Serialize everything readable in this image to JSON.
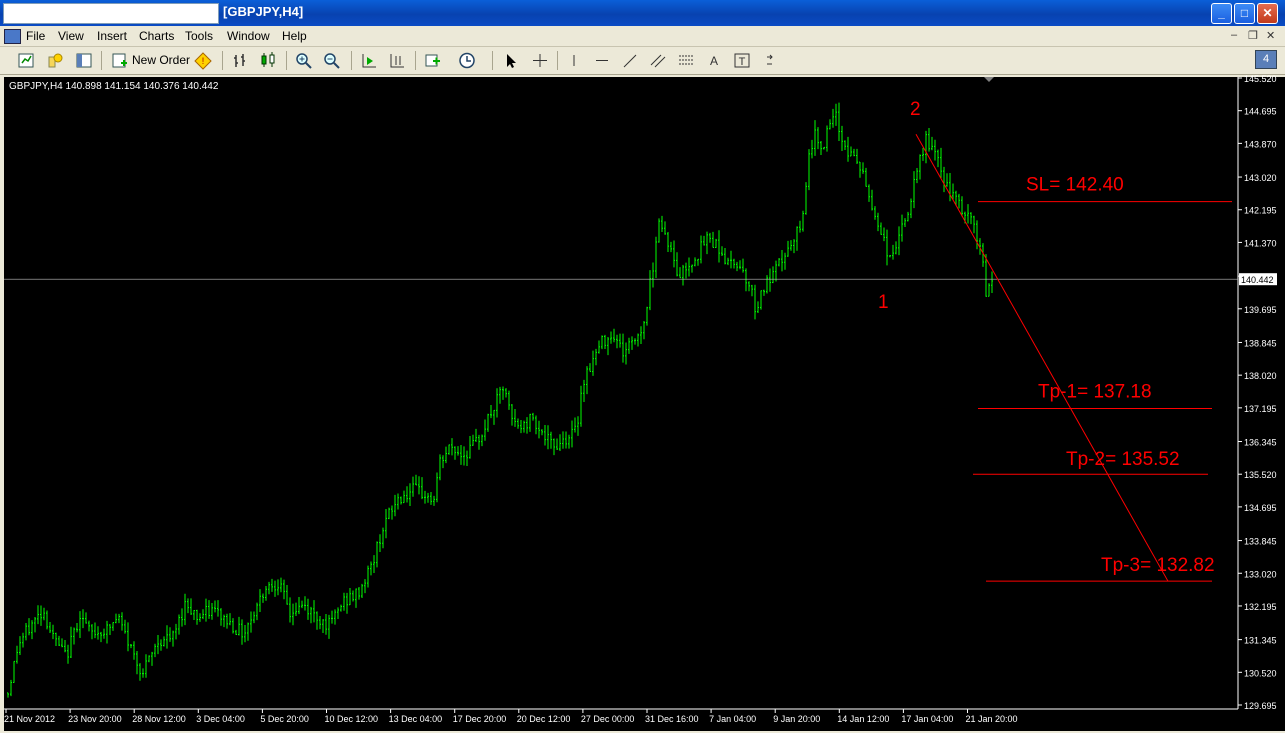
{
  "window": {
    "title": "[GBPJPY,H4]",
    "minimize": "_",
    "maximize": "□",
    "close": "✕"
  },
  "menu": {
    "items": [
      "File",
      "View",
      "Insert",
      "Charts",
      "Tools",
      "Window",
      "Help"
    ]
  },
  "toolbar": {
    "new_order_label": "New Order",
    "badge": "4"
  },
  "colors": {
    "candle": "#00ff00",
    "annotation": "#ff0000",
    "background": "#000000",
    "axis_text": "#ffffff",
    "price_line": "#c0c0c0"
  },
  "chart_data": {
    "type": "candlestick",
    "symbol_info": "GBPJPY,H4  140.898 141.154 140.376 140.442",
    "current_price": 140.442,
    "current_price_label": "140.442",
    "ylim": [
      129.695,
      145.52
    ],
    "y_ticks": [
      "145.520",
      "144.695",
      "143.870",
      "143.020",
      "142.195",
      "141.370",
      "140.520",
      "139.695",
      "138.845",
      "138.020",
      "137.195",
      "136.345",
      "135.520",
      "134.695",
      "133.845",
      "133.020",
      "132.195",
      "131.345",
      "130.520",
      "129.695"
    ],
    "x_ticks": [
      "21 Nov 2012",
      "23 Nov 20:00",
      "28 Nov 12:00",
      "3 Dec 04:00",
      "5 Dec 20:00",
      "10 Dec 12:00",
      "13 Dec 04:00",
      "17 Dec 20:00",
      "20 Dec 12:00",
      "27 Dec 00:00",
      "31 Dec 16:00",
      "7 Jan 04:00",
      "9 Jan 20:00",
      "14 Jan 12:00",
      "17 Jan 04:00",
      "21 Jan 20:00"
    ],
    "price_path": [
      [
        0,
        130.0
      ],
      [
        10,
        131.2
      ],
      [
        20,
        131.6
      ],
      [
        35,
        132.1
      ],
      [
        45,
        131.4
      ],
      [
        58,
        130.9
      ],
      [
        72,
        132.0
      ],
      [
        82,
        131.5
      ],
      [
        100,
        131.6
      ],
      [
        110,
        131.9
      ],
      [
        125,
        131.0
      ],
      [
        135,
        130.5
      ],
      [
        150,
        131.3
      ],
      [
        165,
        131.4
      ],
      [
        178,
        132.3
      ],
      [
        190,
        131.9
      ],
      [
        205,
        132.1
      ],
      [
        220,
        131.8
      ],
      [
        235,
        131.5
      ],
      [
        245,
        132.0
      ],
      [
        258,
        132.7
      ],
      [
        270,
        132.8
      ],
      [
        282,
        132.0
      ],
      [
        295,
        132.2
      ],
      [
        310,
        131.9
      ],
      [
        322,
        131.7
      ],
      [
        335,
        132.3
      ],
      [
        350,
        132.5
      ],
      [
        365,
        133.3
      ],
      [
        375,
        134.2
      ],
      [
        390,
        134.9
      ],
      [
        405,
        135.1
      ],
      [
        418,
        135.0
      ],
      [
        425,
        134.8
      ],
      [
        432,
        135.8
      ],
      [
        442,
        136.2
      ],
      [
        455,
        136.0
      ],
      [
        468,
        136.3
      ],
      [
        478,
        136.8
      ],
      [
        488,
        137.3
      ],
      [
        495,
        137.7
      ],
      [
        505,
        136.8
      ],
      [
        515,
        136.7
      ],
      [
        525,
        137.0
      ],
      [
        535,
        136.5
      ],
      [
        545,
        136.2
      ],
      [
        555,
        136.4
      ],
      [
        568,
        136.6
      ],
      [
        575,
        137.9
      ],
      [
        585,
        138.4
      ],
      [
        595,
        138.9
      ],
      [
        605,
        139.1
      ],
      [
        615,
        138.6
      ],
      [
        625,
        138.9
      ],
      [
        635,
        139.2
      ],
      [
        645,
        140.8
      ],
      [
        650,
        142.0
      ],
      [
        660,
        141.4
      ],
      [
        670,
        140.5
      ],
      [
        680,
        140.8
      ],
      [
        690,
        141.1
      ],
      [
        700,
        141.5
      ],
      [
        710,
        141.3
      ],
      [
        720,
        140.8
      ],
      [
        730,
        140.9
      ],
      [
        740,
        140.4
      ],
      [
        748,
        139.7
      ],
      [
        755,
        140.2
      ],
      [
        765,
        140.5
      ],
      [
        775,
        141.0
      ],
      [
        785,
        141.3
      ],
      [
        795,
        142.0
      ],
      [
        800,
        143.6
      ],
      [
        808,
        144.1
      ],
      [
        815,
        143.8
      ],
      [
        822,
        144.3
      ],
      [
        828,
        144.5
      ],
      [
        835,
        143.9
      ],
      [
        842,
        143.6
      ],
      [
        850,
        143.4
      ],
      [
        858,
        142.8
      ],
      [
        866,
        142.1
      ],
      [
        874,
        141.6
      ],
      [
        882,
        140.9
      ],
      [
        890,
        141.5
      ],
      [
        898,
        141.9
      ],
      [
        905,
        142.7
      ],
      [
        912,
        143.4
      ],
      [
        918,
        144.0
      ],
      [
        925,
        143.7
      ],
      [
        932,
        143.2
      ],
      [
        940,
        142.7
      ],
      [
        948,
        142.4
      ],
      [
        956,
        142.1
      ],
      [
        964,
        141.9
      ],
      [
        972,
        141.3
      ],
      [
        978,
        140.1
      ],
      [
        984,
        140.4
      ],
      [
        986,
        140.442
      ]
    ],
    "annotations": {
      "sl": {
        "label": "SL= 142.40",
        "price": 142.4
      },
      "tp1": {
        "label": "Tp-1= 137.18",
        "price": 137.18
      },
      "tp2": {
        "label": "Tp-2= 135.52",
        "price": 135.52
      },
      "tp3": {
        "label": "Tp-3= 132.82",
        "price": 132.82
      },
      "point1": "1",
      "point2": "2",
      "trendline": {
        "from_price": 144.1,
        "to_price": 132.82
      }
    }
  }
}
